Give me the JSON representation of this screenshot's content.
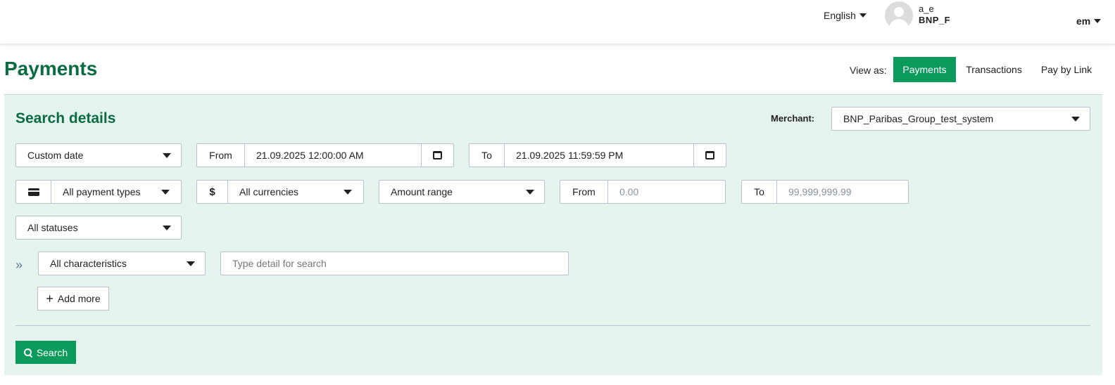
{
  "header": {
    "language": "English",
    "user_name": "a_e",
    "user_org": "BNP_F",
    "user_menu": "em"
  },
  "page": {
    "title": "Payments",
    "view_as_label": "View as:",
    "views": [
      {
        "label": "Payments",
        "active": true
      },
      {
        "label": "Transactions",
        "active": false
      },
      {
        "label": "Pay by Link",
        "active": false
      }
    ]
  },
  "search": {
    "title": "Search details",
    "merchant_label": "Merchant:",
    "merchant_value": "BNP_Paribas_Group_test_system",
    "date_mode": "Custom date",
    "date_from_label": "From",
    "date_from_value": "21.09.2025 12:00:00 AM",
    "date_to_label": "To",
    "date_to_value": "21.09.2025 11:59:59 PM",
    "payment_type": "All payment types",
    "currency_symbol": "$",
    "currency": "All currencies",
    "amount_mode": "Amount range",
    "amount_from_label": "From",
    "amount_from_placeholder": "0.00",
    "amount_to_label": "To",
    "amount_to_placeholder": "99,999,999.99",
    "status": "All statuses",
    "expand_glyph": "»",
    "characteristic": "All characteristics",
    "detail_placeholder": "Type detail for search",
    "add_more_label": "Add more",
    "search_button_label": "Search"
  },
  "colors": {
    "brand_green": "#0a6b43",
    "button_green": "#0a9a5c",
    "panel_bg": "#e5f4ee"
  }
}
